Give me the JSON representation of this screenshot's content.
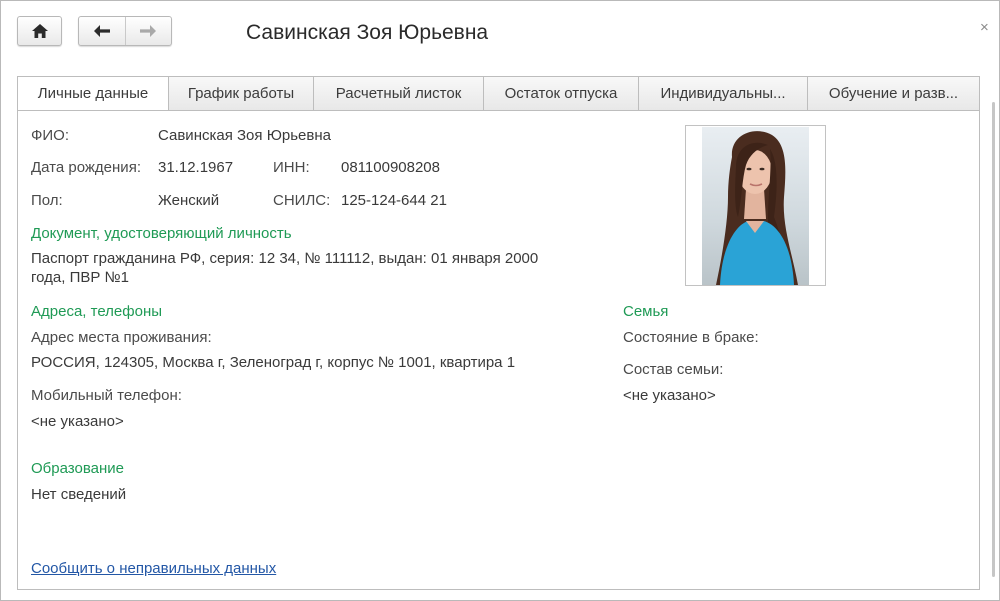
{
  "window": {
    "title": "Савинская Зоя Юрьевна",
    "close_symbol": "×",
    "home_icon": "home-icon",
    "back_icon": "arrow-left-icon",
    "forward_icon": "arrow-right-icon"
  },
  "tabs": [
    {
      "label": "Личные данные",
      "active": true
    },
    {
      "label": "График работы",
      "active": false
    },
    {
      "label": "Расчетный листок",
      "active": false
    },
    {
      "label": "Остаток отпуска",
      "active": false
    },
    {
      "label": "Индивидуальны...",
      "active": false
    },
    {
      "label": "Обучение и разв...",
      "active": false
    }
  ],
  "personal": {
    "fio_label": "ФИО:",
    "fio_value": "Савинская Зоя Юрьевна",
    "birth_label": "Дата рождения:",
    "birth_value": "31.12.1967",
    "inn_label": "ИНН:",
    "inn_value": "081100908208",
    "gender_label": "Пол:",
    "gender_value": "Женский",
    "snils_label": "СНИЛС:",
    "snils_value": "125-124-644 21"
  },
  "document": {
    "heading": "Документ, удостоверяющий личность",
    "line1": "Паспорт гражданина РФ, серия: 12 34, № 111112, выдан: 01 января 2000",
    "line2": "года, ПВР №1"
  },
  "addresses": {
    "heading": "Адреса, телефоны",
    "residence_label": "Адрес места проживания:",
    "residence_value": "РОССИЯ, 124305, Москва г, Зеленоград г, корпус № 1001, квартира 1",
    "mobile_label": "Мобильный телефон:",
    "mobile_value": "<не указано>"
  },
  "education": {
    "heading": "Образование",
    "value": "Нет сведений"
  },
  "family": {
    "heading": "Семья",
    "marital_label": "Состояние в браке:",
    "composition_label": "Состав семьи:",
    "composition_value": "<не указано>"
  },
  "report_link": "Сообщить о неправильных данных",
  "colors": {
    "section_heading": "#1f9a55",
    "link": "#2357a6"
  }
}
